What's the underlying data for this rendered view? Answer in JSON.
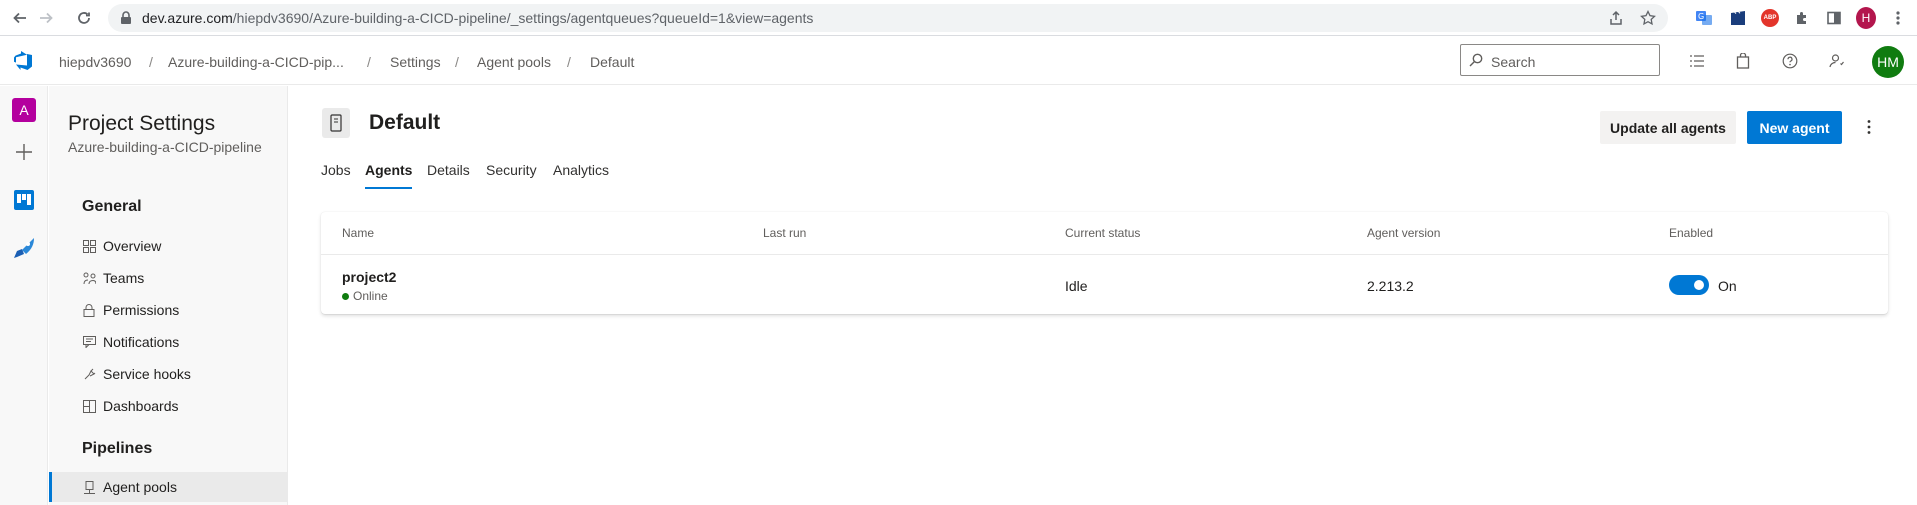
{
  "browser": {
    "url_host": "dev.azure.com",
    "url_path": "/hiepdv3690/Azure-building-a-CICD-pipeline/_settings/agentqueues?queueId=1&view=agents",
    "profile_initial": "H",
    "extension_abp": "ABP"
  },
  "header": {
    "breadcrumbs": [
      "hiepdv3690",
      "Azure-building-a-CICD-pip...",
      "Settings",
      "Agent pools",
      "Default"
    ],
    "search_placeholder": "Search",
    "user_initials": "HM"
  },
  "rail": {
    "project_initial": "A"
  },
  "settings_nav": {
    "title": "Project Settings",
    "subtitle": "Azure-building-a-CICD-pipeline",
    "general_label": "General",
    "general_items": [
      {
        "label": "Overview",
        "icon": "overview-icon"
      },
      {
        "label": "Teams",
        "icon": "teams-icon"
      },
      {
        "label": "Permissions",
        "icon": "lock-icon"
      },
      {
        "label": "Notifications",
        "icon": "notification-icon"
      },
      {
        "label": "Service hooks",
        "icon": "service-hooks-icon"
      },
      {
        "label": "Dashboards",
        "icon": "dashboards-icon"
      }
    ],
    "pipelines_label": "Pipelines",
    "pipelines_items": [
      {
        "label": "Agent pools",
        "icon": "agent-pools-icon",
        "selected": true
      }
    ]
  },
  "main": {
    "title": "Default",
    "update_button": "Update all agents",
    "new_button": "New agent",
    "tabs": [
      {
        "label": "Jobs",
        "active": false
      },
      {
        "label": "Agents",
        "active": true
      },
      {
        "label": "Details",
        "active": false
      },
      {
        "label": "Security",
        "active": false
      },
      {
        "label": "Analytics",
        "active": false
      }
    ],
    "table": {
      "columns": [
        "Name",
        "Last run",
        "Current status",
        "Agent version",
        "Enabled"
      ],
      "rows": [
        {
          "name": "project2",
          "connection": "Online",
          "last_run": "",
          "status": "Idle",
          "version": "2.213.2",
          "enabled": "On"
        }
      ]
    }
  },
  "colors": {
    "accent": "#0078d4",
    "online": "#107c10",
    "avatar": "#107c10",
    "project_badge": "#b4009e"
  }
}
